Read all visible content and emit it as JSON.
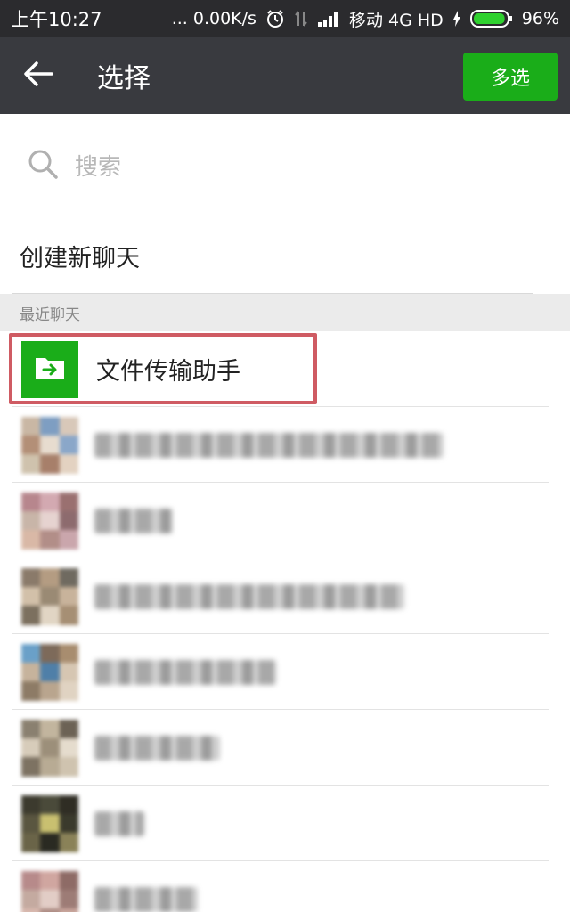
{
  "status_bar": {
    "time": "上午10:27",
    "network_speed": "... 0.00K/s",
    "carrier": "移动 4G HD",
    "battery": "96%",
    "battery_level": 0.96
  },
  "header": {
    "title": "选择",
    "multi_select_label": "多选"
  },
  "search": {
    "placeholder": "搜索"
  },
  "create_new_chat_label": "创建新聊天",
  "recent_section_label": "最近聊天",
  "chats": [
    {
      "name": "文件传输助手",
      "highlighted": true
    }
  ],
  "blurred_chat_count": 7,
  "colors": {
    "accent_green": "#1aad19",
    "title_bar": "#393a3f",
    "status_bar": "#2b2b2e",
    "highlight_border": "#cf5b63"
  }
}
